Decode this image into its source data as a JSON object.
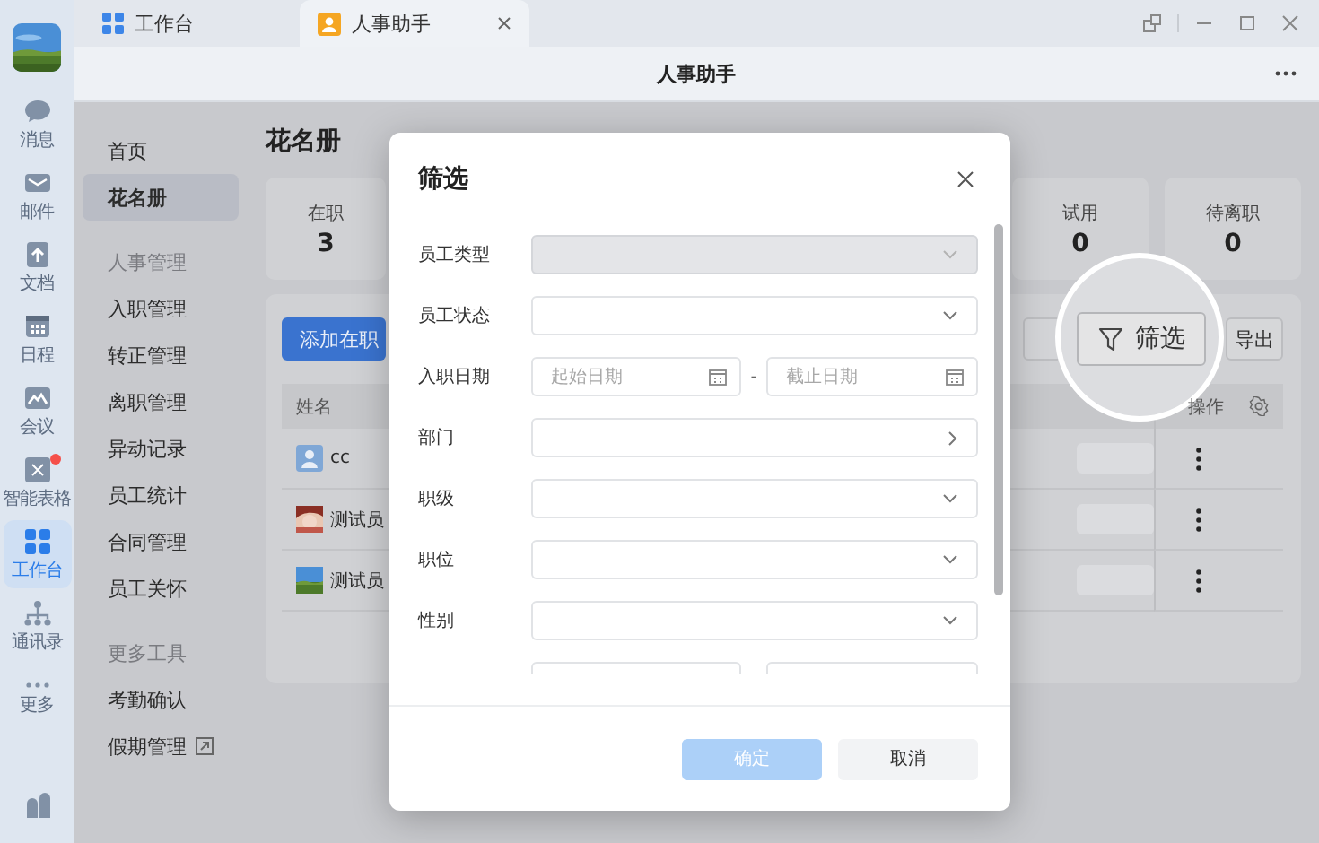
{
  "tabs": [
    {
      "label": "工作台",
      "selected": false
    },
    {
      "label": "人事助手",
      "selected": true
    }
  ],
  "app_title": "人事助手",
  "rail": [
    {
      "label": "消息",
      "selected": false,
      "badge": false
    },
    {
      "label": "邮件",
      "selected": false,
      "badge": false
    },
    {
      "label": "文档",
      "selected": false,
      "badge": false
    },
    {
      "label": "日程",
      "selected": false,
      "badge": false
    },
    {
      "label": "会议",
      "selected": false,
      "badge": false
    },
    {
      "label": "智能表格",
      "selected": false,
      "badge": true
    },
    {
      "label": "工作台",
      "selected": true,
      "badge": false
    },
    {
      "label": "通讯录",
      "selected": false,
      "badge": false
    },
    {
      "label": "更多",
      "selected": false,
      "badge": false
    }
  ],
  "nav": [
    {
      "kind": "item",
      "label": "首页",
      "selected": false,
      "external": false
    },
    {
      "kind": "item",
      "label": "花名册",
      "selected": true,
      "external": false
    },
    {
      "kind": "group",
      "label": "人事管理"
    },
    {
      "kind": "item",
      "label": "入职管理",
      "selected": false,
      "external": false
    },
    {
      "kind": "item",
      "label": "转正管理",
      "selected": false,
      "external": false
    },
    {
      "kind": "item",
      "label": "离职管理",
      "selected": false,
      "external": false
    },
    {
      "kind": "item",
      "label": "异动记录",
      "selected": false,
      "external": false
    },
    {
      "kind": "item",
      "label": "员工统计",
      "selected": false,
      "external": false
    },
    {
      "kind": "item",
      "label": "合同管理",
      "selected": false,
      "external": false
    },
    {
      "kind": "item",
      "label": "员工关怀",
      "selected": false,
      "external": false
    },
    {
      "kind": "group",
      "label": "更多工具"
    },
    {
      "kind": "item",
      "label": "考勤确认",
      "selected": false,
      "external": false
    },
    {
      "kind": "item",
      "label": "假期管理",
      "selected": false,
      "external": true
    }
  ],
  "page_title": "花名册",
  "stats": [
    {
      "label": "在职",
      "value": "3"
    },
    {
      "label": "试用",
      "value": "0"
    },
    {
      "label": "待离职",
      "value": "0"
    }
  ],
  "toolbar": {
    "add_button": "添加在职",
    "filter_button": "筛选",
    "export_button": "导出"
  },
  "table": {
    "columns": [
      "姓名",
      "操作"
    ],
    "rows": [
      {
        "name": "cc",
        "kind": "icon"
      },
      {
        "name": "测试员",
        "kind": "picture"
      },
      {
        "name": "测试员",
        "kind": "picture"
      }
    ]
  },
  "dialog": {
    "title": "筛选",
    "fields": [
      {
        "kind": "select",
        "label": "员工类型",
        "disabled": true
      },
      {
        "kind": "select",
        "label": "员工状态",
        "disabled": false
      },
      {
        "kind": "date_range",
        "label": "入职日期",
        "start_placeholder": "起始日期",
        "separator": "-",
        "end_placeholder": "截止日期",
        "disabled": false
      },
      {
        "kind": "picker",
        "label": "部门",
        "disabled": false
      },
      {
        "kind": "select",
        "label": "职级",
        "disabled": false
      },
      {
        "kind": "select",
        "label": "职位",
        "disabled": false
      },
      {
        "kind": "select",
        "label": "性别",
        "disabled": false
      },
      {
        "kind": "date_range",
        "disabled": false
      }
    ],
    "buttons": [
      {
        "kind": "primary",
        "label": "确定",
        "disabled": true
      },
      {
        "kind": "default",
        "label": "取消",
        "disabled": false
      }
    ]
  }
}
